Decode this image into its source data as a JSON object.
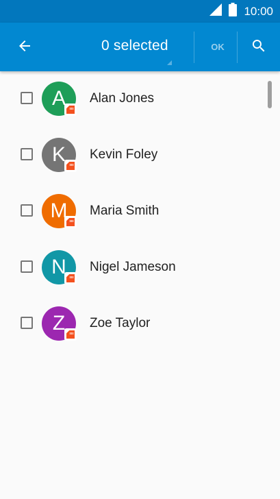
{
  "status_bar": {
    "time": "10:00",
    "icons": [
      "signal-icon",
      "battery-icon"
    ]
  },
  "app_bar": {
    "title": "0 selected",
    "ok_label": "OK",
    "back_icon": "arrow-back-icon",
    "search_icon": "search-icon",
    "background_color": "#0288d1"
  },
  "contacts": [
    {
      "initial": "A",
      "name": "Alan Jones",
      "color": "#1e9e58",
      "checked": false
    },
    {
      "initial": "K",
      "name": "Kevin Foley",
      "color": "#757575",
      "checked": false
    },
    {
      "initial": "M",
      "name": "Maria Smith",
      "color": "#ef6c00",
      "checked": false
    },
    {
      "initial": "N",
      "name": "Nigel Jameson",
      "color": "#1197a6",
      "checked": false
    },
    {
      "initial": "Z",
      "name": "Zoe Taylor",
      "color": "#9c27b0",
      "checked": false
    }
  ],
  "badge": {
    "icon": "sim-card-icon",
    "color": "#f4511e"
  }
}
